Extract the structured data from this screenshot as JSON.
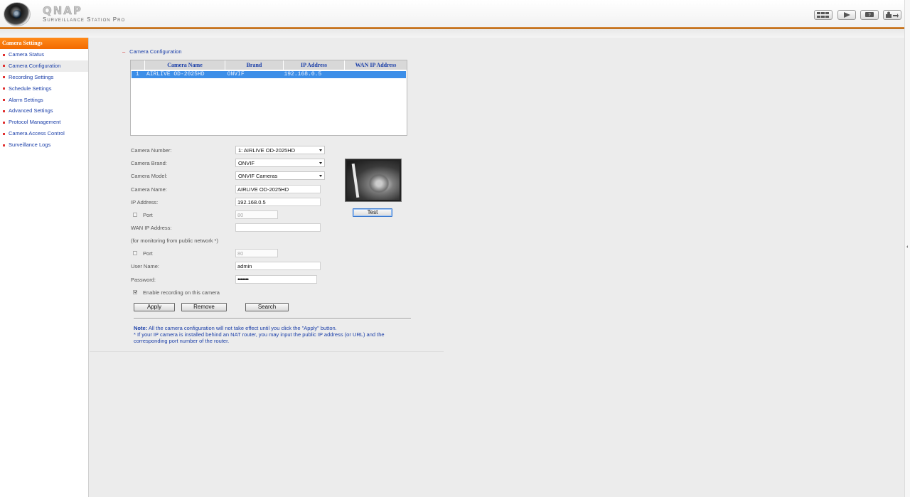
{
  "header": {
    "brand": "QNAP",
    "product": "Surveillance Station Pro",
    "buttons": [
      {
        "name": "monitor-layout-icon"
      },
      {
        "name": "playback-icon"
      },
      {
        "name": "help-icon"
      },
      {
        "name": "logout-icon"
      }
    ]
  },
  "sidebar": {
    "title": "Camera Settings",
    "items": [
      {
        "label": "Camera Status"
      },
      {
        "label": "Camera Configuration"
      },
      {
        "label": "Recording Settings"
      },
      {
        "label": "Schedule Settings"
      },
      {
        "label": "Alarm Settings"
      },
      {
        "label": "Advanced Settings"
      },
      {
        "label": "Protocol Management"
      },
      {
        "label": "Camera Access Control"
      },
      {
        "label": "Surveillance Logs"
      }
    ]
  },
  "main": {
    "section_title": "Camera Configuration",
    "table": {
      "headers": [
        "",
        "Camera Name",
        "Brand",
        "IP Address",
        "WAN IP Address"
      ],
      "rows": [
        {
          "num": "1",
          "name": "AIRLIVE OD-2025HD",
          "brand": "ONVIF",
          "ip": "192.168.0.5",
          "wan_ip": ""
        }
      ]
    },
    "form": {
      "camera_number_label": "Camera Number:",
      "camera_number_value": "1: AIRLIVE OD-2025HD",
      "camera_brand_label": "Camera Brand:",
      "camera_brand_value": "ONVIF",
      "camera_model_label": "Camera Model:",
      "camera_model_value": "ONVIF Cameras",
      "camera_name_label": "Camera Name:",
      "camera_name_value": "AIRLIVE OD-2025HD",
      "ip_label": "IP Address:",
      "ip_value": "192.168.0.5",
      "port_label": "Port",
      "port_value": "80",
      "wan_ip_label": "WAN IP Address:",
      "wan_ip_value": "",
      "wan_note": "(for monitoring from public network *)",
      "wan_port_label": "Port",
      "wan_port_value": "80",
      "username_label": "User Name:",
      "username_value": "admin",
      "password_label": "Password:",
      "password_value": "•••••••",
      "enable_recording_label": "Enable recording on this camera",
      "enable_recording_checked": true
    },
    "buttons": {
      "test": "Test",
      "apply": "Apply",
      "remove": "Remove",
      "search": "Search"
    },
    "note": {
      "prefix": "Note:",
      "line1": " All the camera configuration will not take effect until you click the \"Apply\" button.",
      "line2": "* If your IP camera is installed behind an NAT router, you may input the public IP address (or URL) and the corresponding port number of the router."
    }
  },
  "colors": {
    "accent_orange": "#f26a00",
    "link_blue": "#1a3ea8",
    "selection_blue": "#3c8ee8"
  }
}
